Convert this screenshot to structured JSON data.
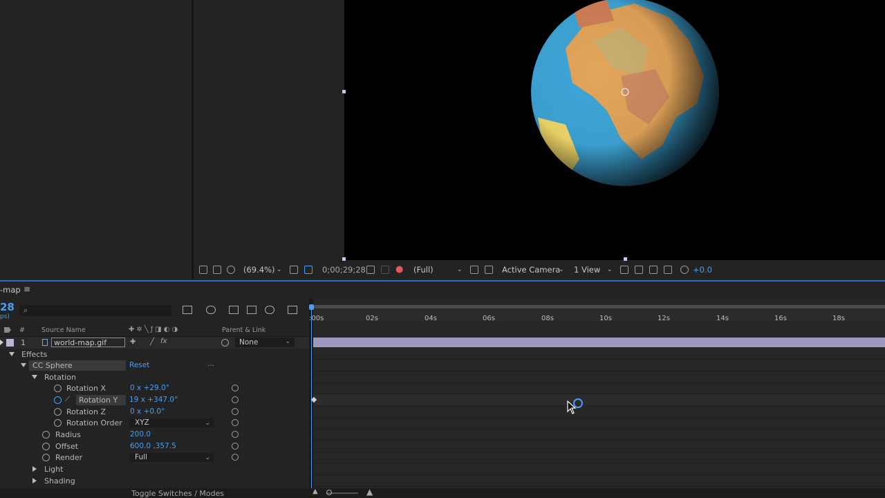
{
  "viewer": {
    "zoom": "(69.4%)",
    "timecode": "0;00;29;28",
    "resolution": "(Full)",
    "camera": "Active Camera",
    "view_layout": "1 View",
    "exposure": "+0.0"
  },
  "timeline": {
    "comp_name": "-map",
    "menu_glyph": "≡",
    "current_frame": "28",
    "fps_fragment": "ps)",
    "search_placeholder": "",
    "ruler_ticks": [
      ":00s",
      "02s",
      "04s",
      "06s",
      "08s",
      "10s",
      "12s",
      "14s",
      "16s",
      "18s"
    ],
    "columns": {
      "number": "#",
      "source_name": "Source Name",
      "parent_link": "Parent & Link"
    },
    "layer": {
      "index": "1",
      "name": "world-map.gif",
      "parent": "None"
    },
    "properties": {
      "effects": "Effects",
      "effect_name": "CC Sphere",
      "reset": "Reset",
      "reset_dots": "...",
      "rotation_group": "Rotation",
      "rotation_x_label": "Rotation X",
      "rotation_x_value": "0 x +29.0°",
      "rotation_y_label": "Rotation Y",
      "rotation_y_value": "19 x +347.0°",
      "rotation_z_label": "Rotation Z",
      "rotation_z_value": "0 x +0.0°",
      "rotation_order_label": "Rotation Order",
      "rotation_order_value": "XYZ",
      "radius_label": "Radius",
      "radius_value": "200.0",
      "offset_label": "Offset",
      "offset_value": "600.0 ,357.5",
      "render_label": "Render",
      "render_value": "Full",
      "light_label": "Light",
      "shading_label": "Shading"
    },
    "toggle_label": "Toggle Switches / Modes"
  },
  "colors": {
    "accent": "#4a9ff5",
    "layer_bar": "#9c97bf",
    "canvas": "#000000"
  }
}
